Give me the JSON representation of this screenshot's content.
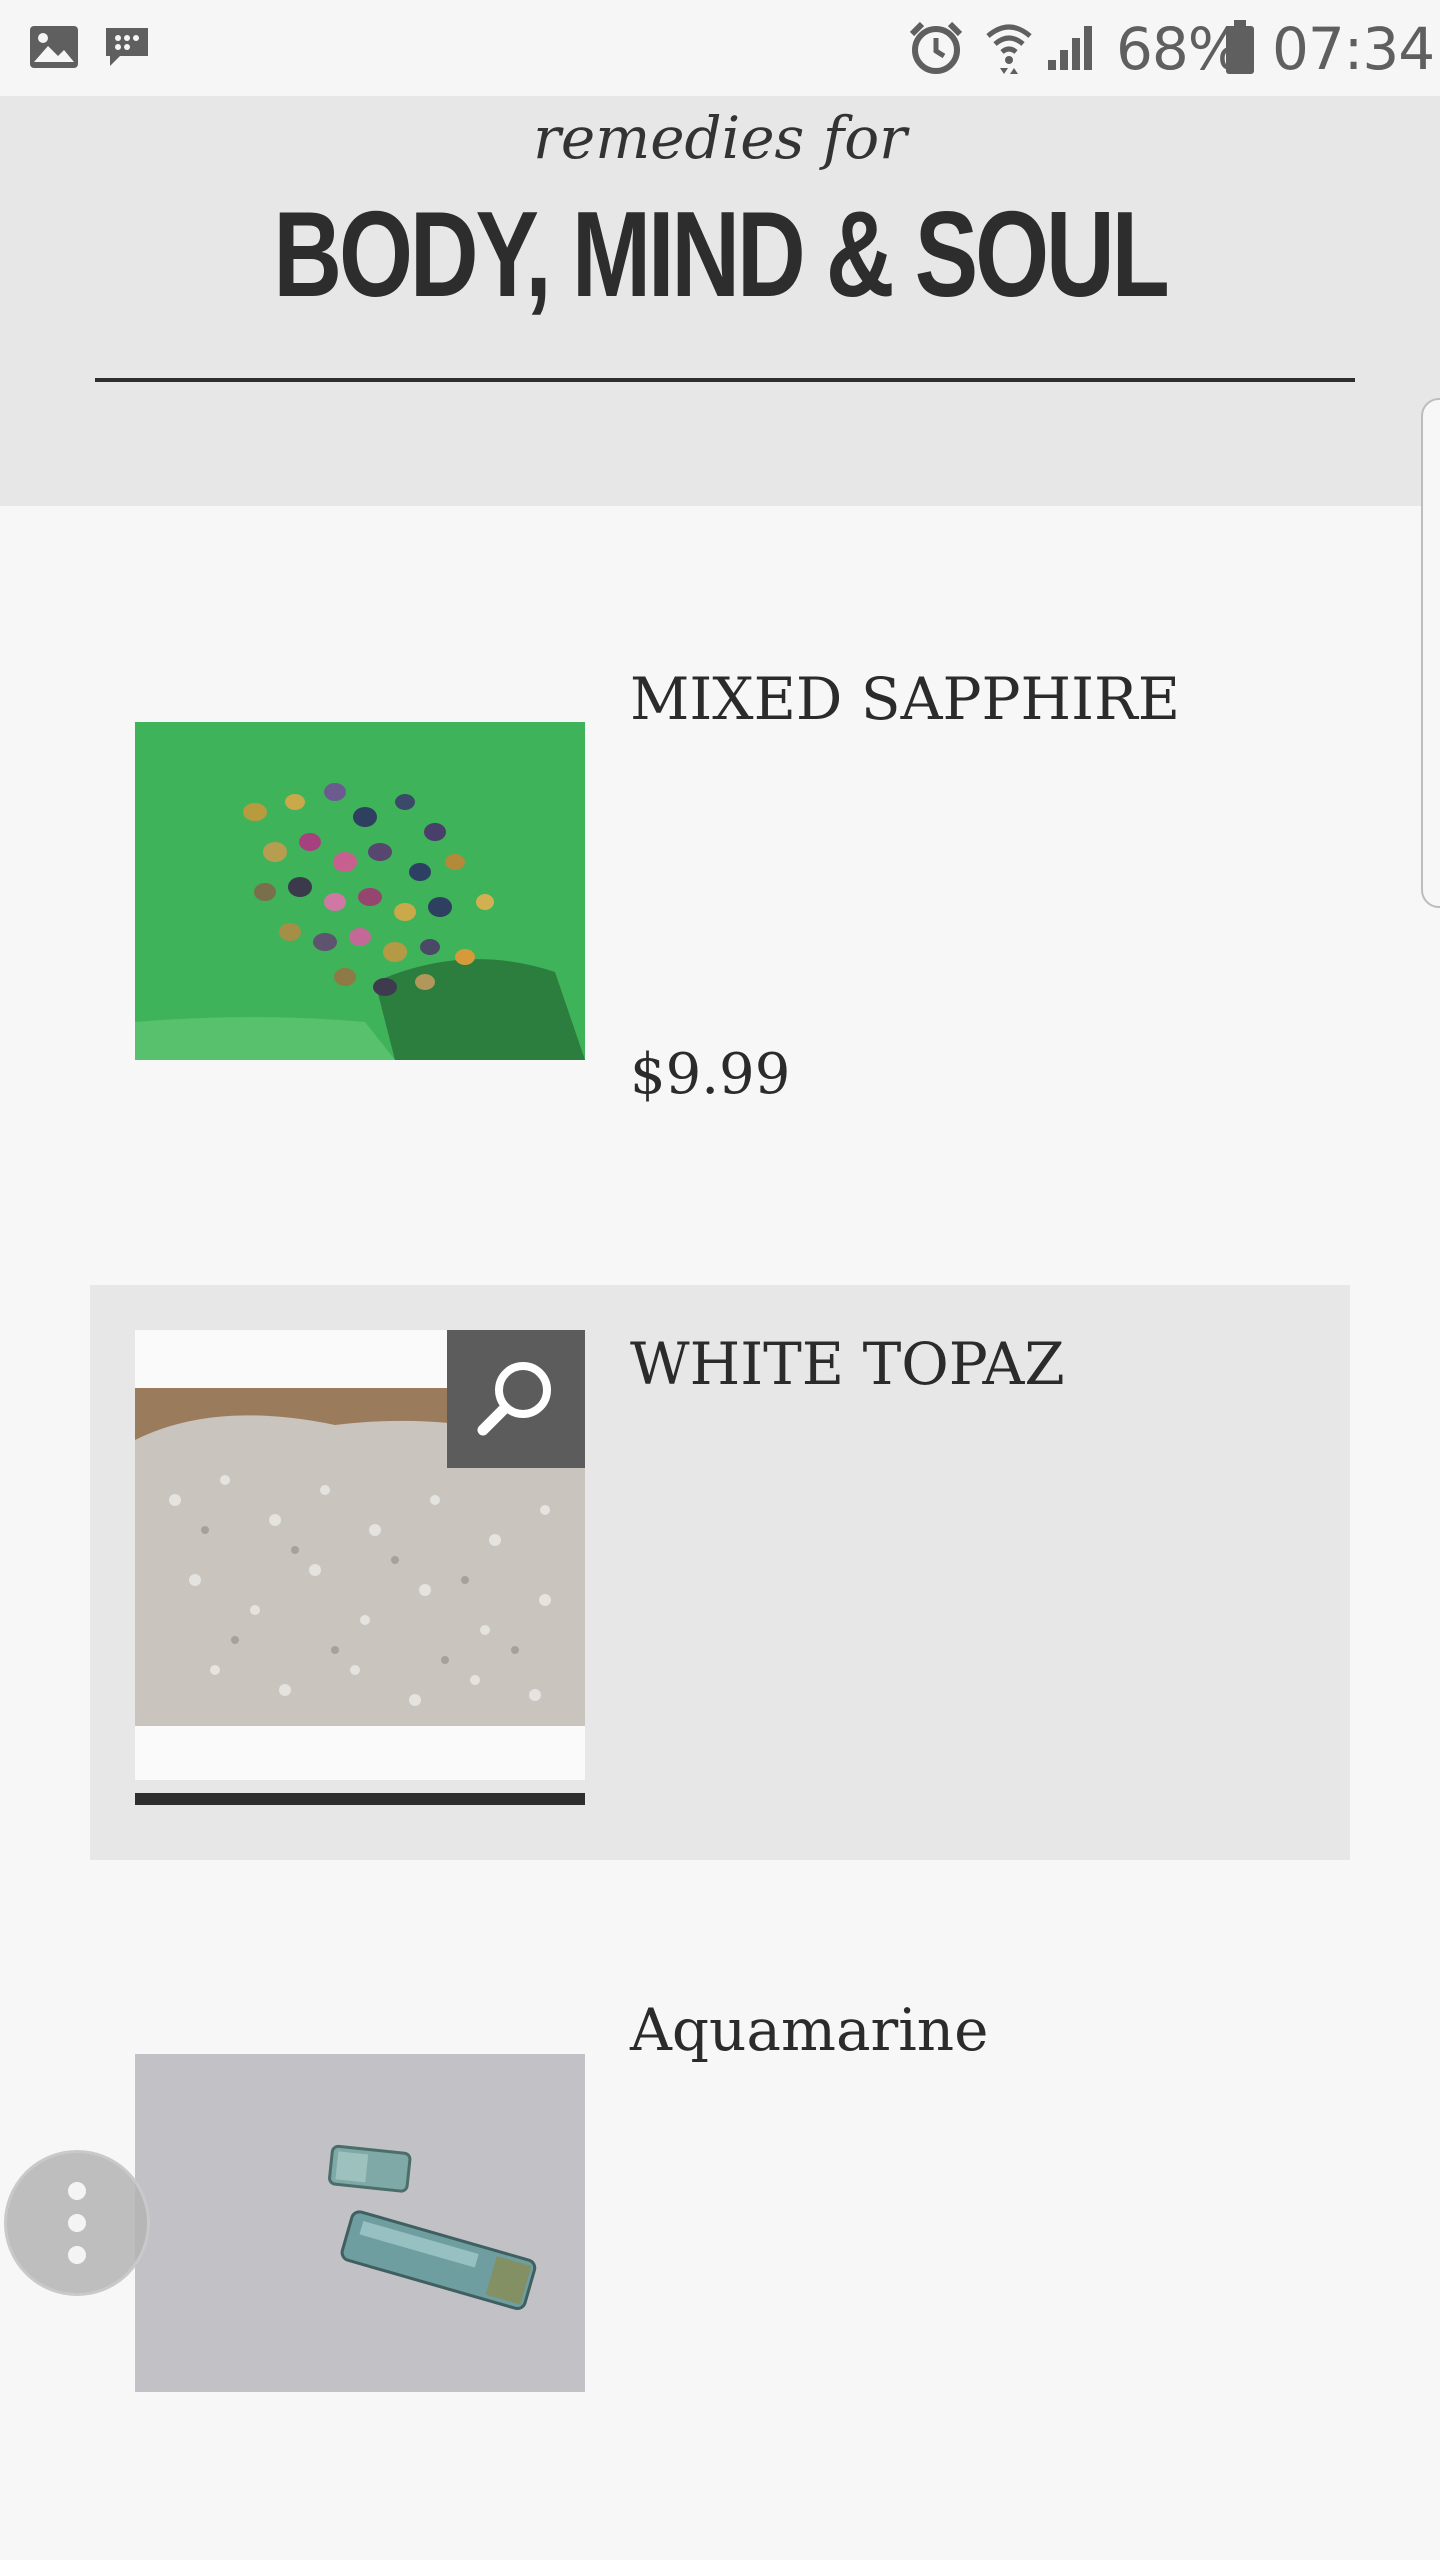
{
  "status_bar": {
    "battery": "68%",
    "time": "07:34",
    "icons": [
      "image-icon",
      "messenger-icon",
      "alarm-icon",
      "wifi-icon",
      "signal-icon",
      "battery-icon"
    ]
  },
  "header": {
    "tagline": "remedies for",
    "brand": "BODY, MIND & SOUL"
  },
  "products": [
    {
      "name": "MIXED SAPPHIRE",
      "price": "$9.99",
      "image": "mixed-sapphire-photo"
    },
    {
      "name": "WHITE TOPAZ",
      "price": "",
      "image": "white-topaz-photo",
      "zoom_icon": "magnifier-icon",
      "progress": 1.0
    },
    {
      "name": "Aquamarine",
      "price": "",
      "image": "aquamarine-photo"
    }
  ],
  "colors": {
    "header_bg": "#e7e7e7",
    "page_bg": "#f7f7f7",
    "text": "#2b2b2b",
    "zoom_bg": "#5c5c5c"
  },
  "fab": {
    "icon": "more-vert-icon"
  }
}
